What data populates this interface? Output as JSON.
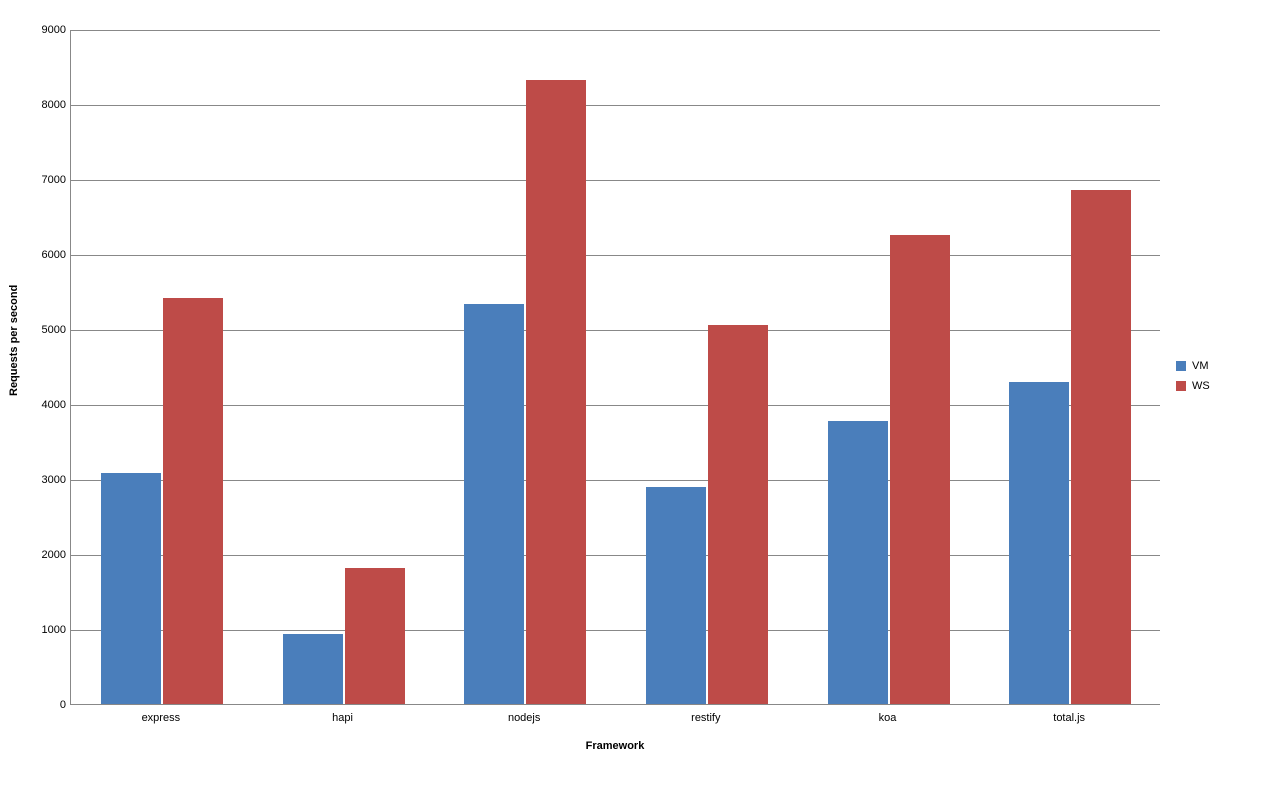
{
  "chart_data": {
    "type": "bar",
    "categories": [
      "express",
      "hapi",
      "nodejs",
      "restify",
      "koa",
      "total.js"
    ],
    "series": [
      {
        "name": "VM",
        "values": [
          3080,
          930,
          5340,
          2900,
          3770,
          4300
        ]
      },
      {
        "name": "WS",
        "values": [
          5420,
          1810,
          8320,
          5060,
          6250,
          6850
        ]
      }
    ],
    "xlabel": "Framework",
    "ylabel": "Requests per second",
    "ylim": [
      0,
      9000
    ],
    "yticks": [
      0,
      1000,
      2000,
      3000,
      4000,
      5000,
      6000,
      7000,
      8000,
      9000
    ],
    "legend_position": "right",
    "grid": true
  },
  "colors": {
    "vm": "#4a7ebb",
    "ws": "#be4b48"
  }
}
